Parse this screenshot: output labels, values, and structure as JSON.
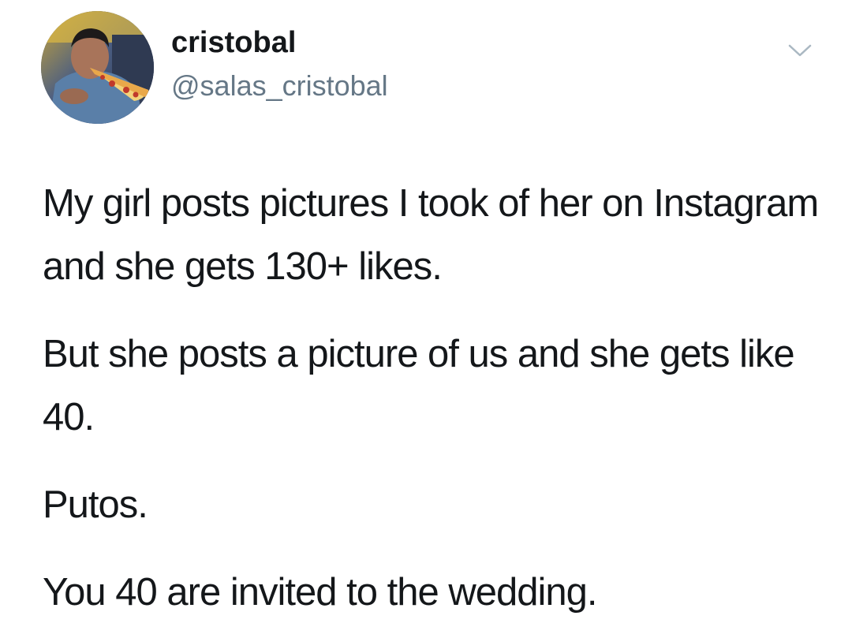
{
  "author": {
    "display_name": "cristobal",
    "handle": "@salas_cristobal",
    "avatar_icon": "user-avatar-eating-pizza"
  },
  "menu": {
    "icon": "chevron-down-icon"
  },
  "tweet": {
    "paragraphs": [
      "My girl posts pictures I took of her on Instagram and she gets 130+ likes.",
      "But she posts a picture of us and she gets like 40.",
      "Putos.",
      "You 40 are invited to the wedding."
    ]
  },
  "colors": {
    "text": "#14171a",
    "secondary_text": "#657786",
    "chevron": "#aab8c2",
    "background": "#ffffff"
  }
}
